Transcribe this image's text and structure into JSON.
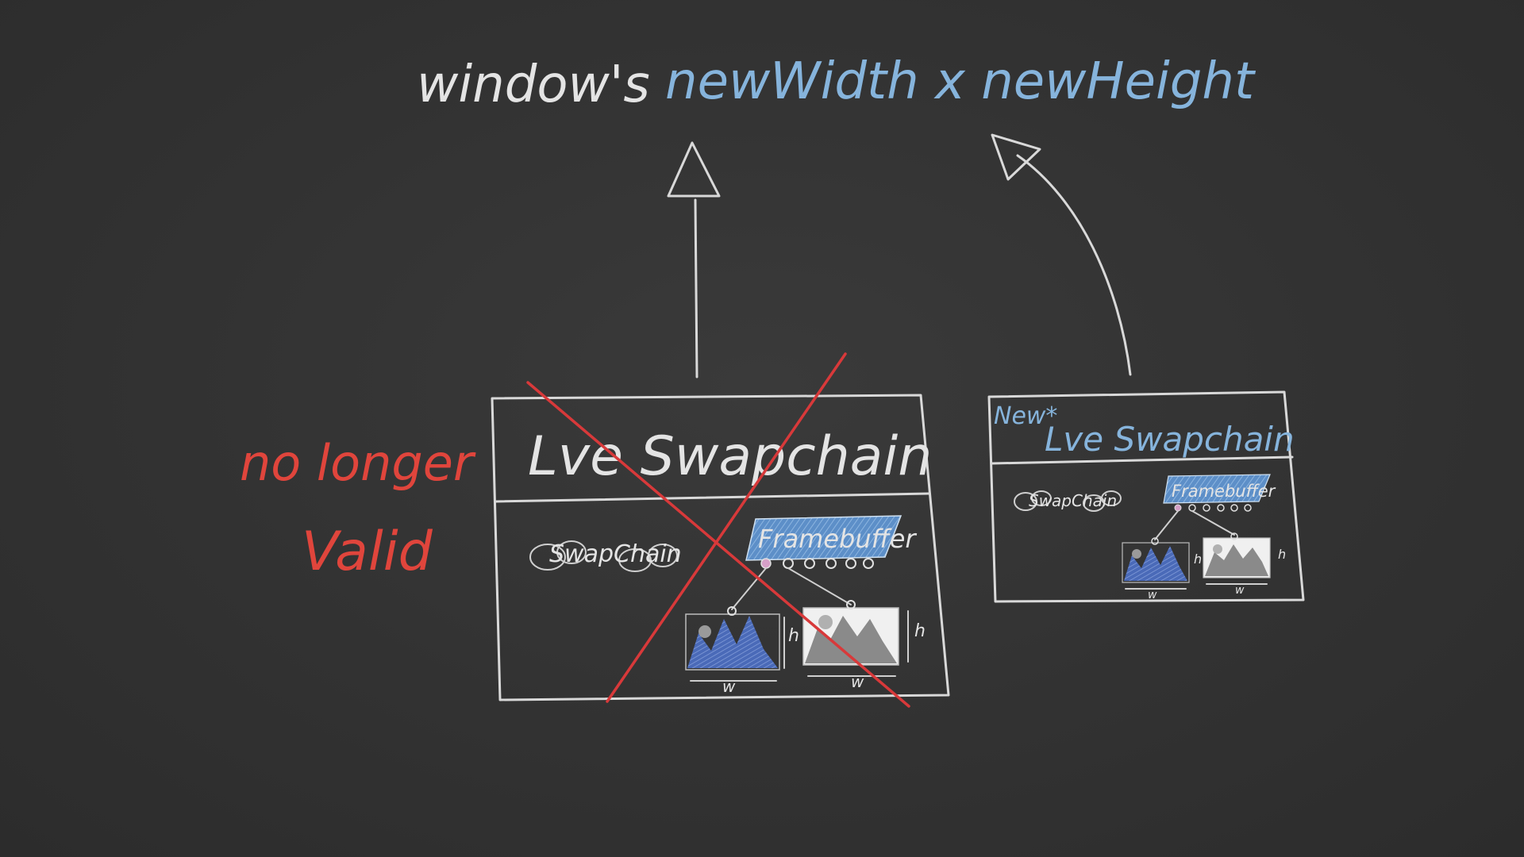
{
  "title": {
    "part1": "window's",
    "part2": "newWidth x newHeight"
  },
  "annotation": {
    "line1": "no longer",
    "line2": "Valid"
  },
  "old_swapchain": {
    "title": "Lve Swapchain",
    "swapchain_label": "SwapChain",
    "framebuffer_label": "Framebuffer",
    "dim_h": "h",
    "dim_w": "w"
  },
  "new_swapchain": {
    "new_label": "New*",
    "title": "Lve Swapchain",
    "swapchain_label": "SwapChain",
    "framebuffer_label": "Framebuffer",
    "dim_h": "h",
    "dim_w": "w"
  },
  "colors": {
    "background": "#333333",
    "chalk_white": "#e4e4e4",
    "chalk_blue": "#86b4dc",
    "chalk_red": "#e0453c",
    "framebuffer_fill": "#5d8fc8",
    "mountain_blue": "#4a6ab8",
    "mountain_gray": "#8a8a8a"
  }
}
